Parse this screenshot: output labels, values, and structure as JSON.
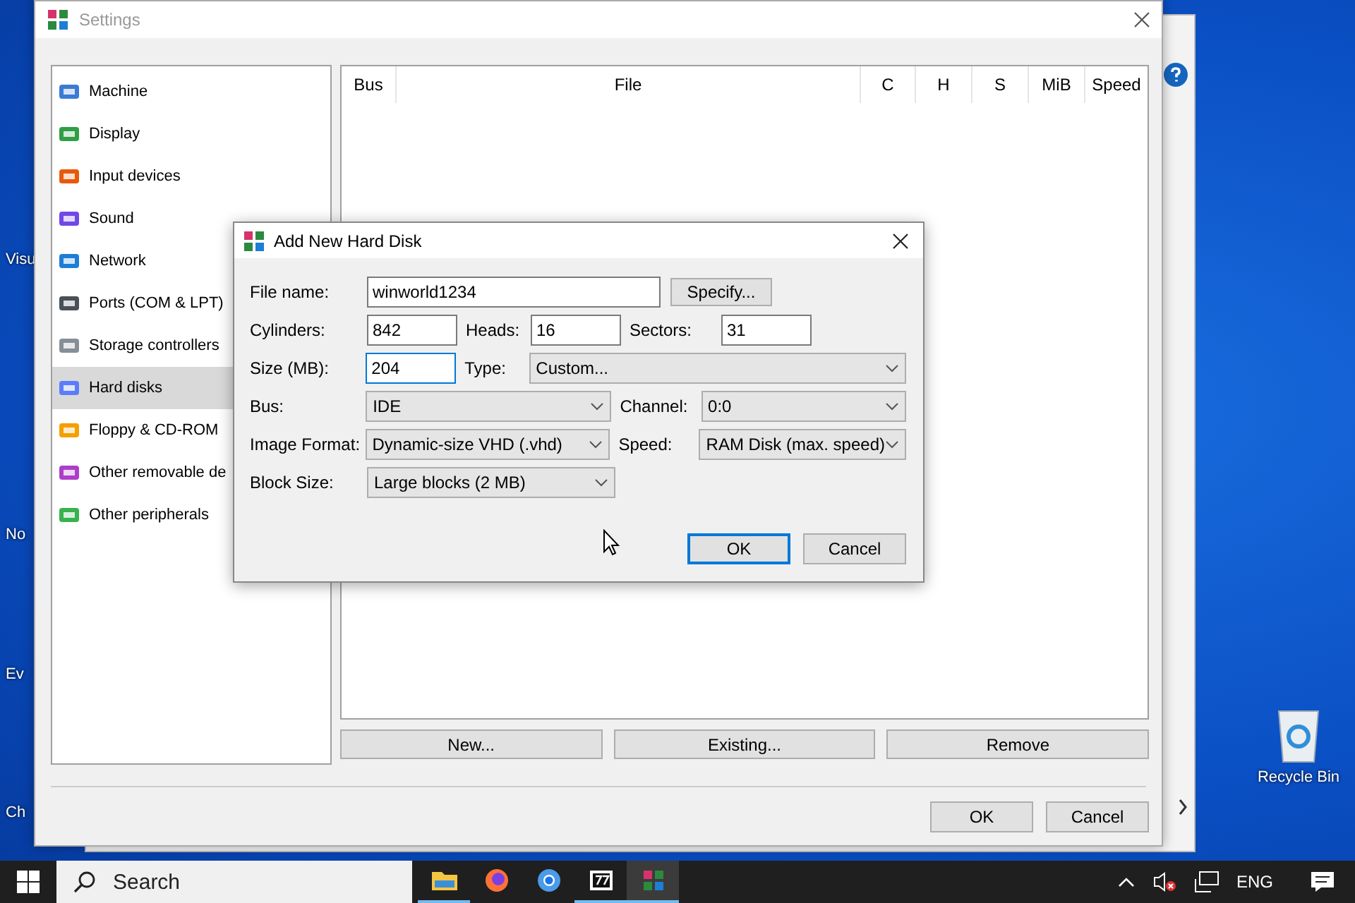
{
  "desktop_icons": [
    {
      "label": "Visu"
    },
    {
      "label": "No"
    },
    {
      "label": "Ev"
    },
    {
      "label": "Ch"
    }
  ],
  "recycle_bin": {
    "label": "Recycle Bin"
  },
  "settings": {
    "title": "Settings",
    "sidebar": [
      {
        "label": "Machine",
        "selected": false
      },
      {
        "label": "Display",
        "selected": false
      },
      {
        "label": "Input devices",
        "selected": false
      },
      {
        "label": "Sound",
        "selected": false
      },
      {
        "label": "Network",
        "selected": false
      },
      {
        "label": "Ports (COM & LPT)",
        "selected": false
      },
      {
        "label": "Storage controllers",
        "selected": false
      },
      {
        "label": "Hard disks",
        "selected": true
      },
      {
        "label": "Floppy & CD-ROM",
        "selected": false
      },
      {
        "label": "Other removable de",
        "selected": false
      },
      {
        "label": "Other peripherals",
        "selected": false
      }
    ],
    "table": {
      "columns": [
        "Bus",
        "File",
        "C",
        "H",
        "S",
        "MiB",
        "Speed"
      ]
    },
    "disk_buttons": [
      "New...",
      "Existing...",
      "Remove"
    ],
    "buttons": [
      "OK",
      "Cancel"
    ]
  },
  "dialog": {
    "title": "Add New Hard Disk",
    "file_name": {
      "label": "File name:",
      "value": "winworld1234",
      "button": "Specify..."
    },
    "cylinders": {
      "label": "Cylinders:",
      "value": "842"
    },
    "heads": {
      "label": "Heads:",
      "value": "16"
    },
    "sectors": {
      "label": "Sectors:",
      "value": "31"
    },
    "size": {
      "label": "Size (MB):",
      "value": "204"
    },
    "type": {
      "label": "Type:",
      "value": "Custom..."
    },
    "bus": {
      "label": "Bus:",
      "value": "IDE"
    },
    "channel": {
      "label": "Channel:",
      "value": "0:0"
    },
    "image_format": {
      "label": "Image Format:",
      "value": "Dynamic-size VHD (.vhd)"
    },
    "speed": {
      "label": "Speed:",
      "value": "RAM Disk (max. speed)"
    },
    "block_size": {
      "label": "Block Size:",
      "value": "Large blocks (2 MB)"
    },
    "buttons": [
      "OK",
      "Cancel"
    ]
  },
  "taskbar": {
    "search": {
      "placeholder": "Search"
    },
    "apps": [
      {
        "kind": "folder",
        "running": true,
        "selected": false
      },
      {
        "kind": "firefox",
        "running": false,
        "selected": false
      },
      {
        "kind": "chrome",
        "running": false,
        "selected": false
      },
      {
        "kind": "sevenzip",
        "running": true,
        "selected": false
      },
      {
        "kind": "emulator",
        "running": true,
        "selected": true
      }
    ],
    "tray": {
      "language": "ENG"
    }
  }
}
